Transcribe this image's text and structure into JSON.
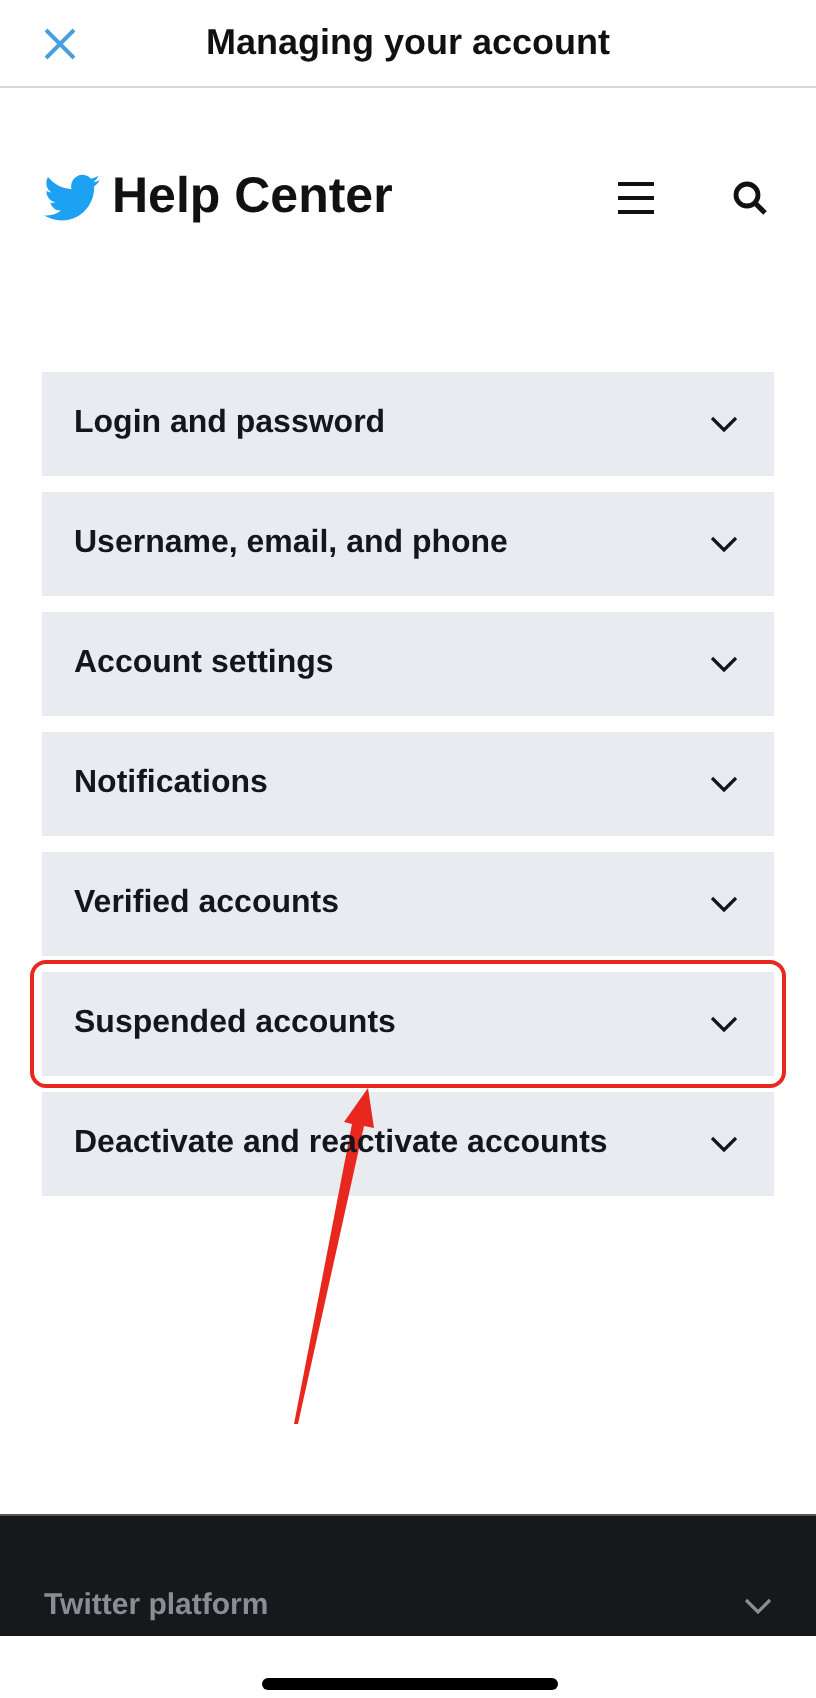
{
  "top_bar": {
    "title": "Managing your account"
  },
  "header": {
    "title": "Help Center"
  },
  "topics": [
    {
      "label": "Login and password",
      "expanded": false,
      "highlighted": false
    },
    {
      "label": "Username, email, and phone",
      "expanded": false,
      "highlighted": false
    },
    {
      "label": "Account settings",
      "expanded": false,
      "highlighted": false
    },
    {
      "label": "Notifications",
      "expanded": false,
      "highlighted": false
    },
    {
      "label": "Verified accounts",
      "expanded": false,
      "highlighted": false
    },
    {
      "label": "Suspended accounts",
      "expanded": false,
      "highlighted": true
    },
    {
      "label": "Deactivate and reactivate accounts",
      "expanded": false,
      "highlighted": false
    }
  ],
  "footer": {
    "sections": [
      {
        "label": "Twitter platform",
        "expanded": false
      }
    ]
  }
}
